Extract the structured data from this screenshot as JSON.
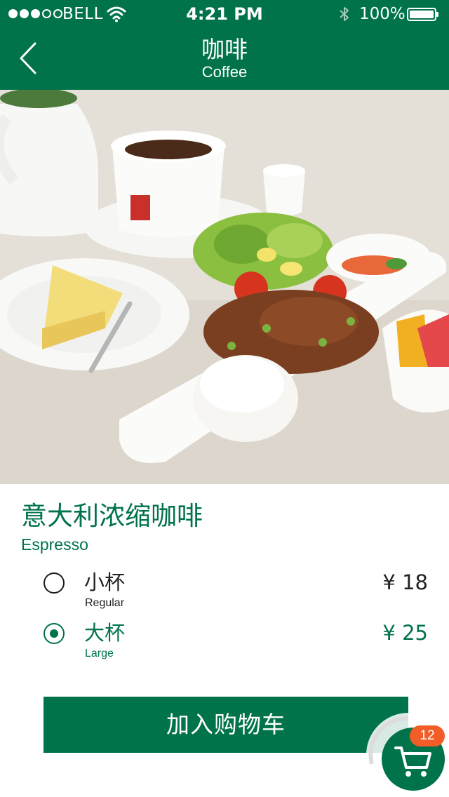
{
  "status_bar": {
    "carrier": "BELL",
    "time": "4:21 PM",
    "battery": "100%",
    "signal_bars": 3,
    "signal_total": 5
  },
  "header": {
    "title": "咖啡",
    "subtitle": "Coffee"
  },
  "product": {
    "name": "意大利浓缩咖啡",
    "name_en": "Espresso",
    "options": [
      {
        "label": "小杯",
        "sublabel": "Regular",
        "price": "¥ 18",
        "selected": false
      },
      {
        "label": "大杯",
        "sublabel": "Large",
        "price": "¥ 25",
        "selected": true
      }
    ]
  },
  "actions": {
    "add_to_cart": "加入购物车"
  },
  "cart": {
    "count": "12"
  },
  "colors": {
    "brand_green": "#00734a",
    "badge_orange": "#f25c27"
  },
  "icons": {
    "back": "chevron-left-icon",
    "cart": "shopping-cart-icon",
    "wifi": "wifi-icon",
    "bluetooth": "bluetooth-icon",
    "battery": "battery-icon"
  }
}
